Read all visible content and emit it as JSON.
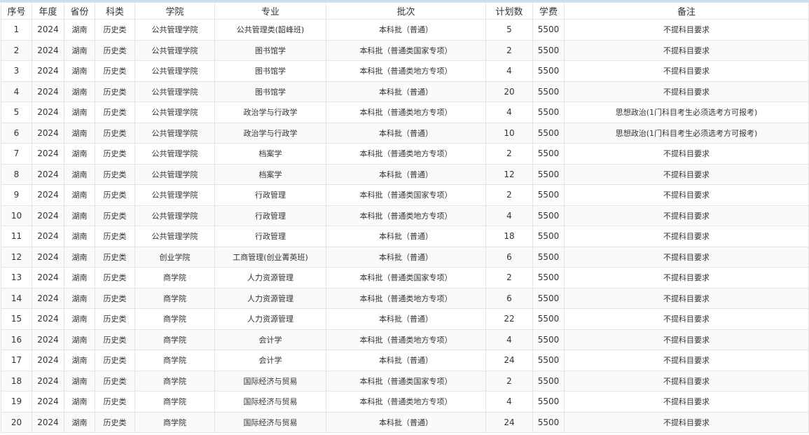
{
  "columns": [
    "序号",
    "年度",
    "省份",
    "科类",
    "学院",
    "专业",
    "批次",
    "计划数",
    "学费",
    "备注"
  ],
  "rows": [
    [
      "1",
      "2024",
      "湖南",
      "历史类",
      "公共管理学院",
      "公共管理类(韶峰班)",
      "本科批（普通）",
      "5",
      "5500",
      "不提科目要求"
    ],
    [
      "2",
      "2024",
      "湖南",
      "历史类",
      "公共管理学院",
      "图书馆学",
      "本科批（普通类国家专项）",
      "2",
      "5500",
      "不提科目要求"
    ],
    [
      "3",
      "2024",
      "湖南",
      "历史类",
      "公共管理学院",
      "图书馆学",
      "本科批（普通类地方专项）",
      "4",
      "5500",
      "不提科目要求"
    ],
    [
      "4",
      "2024",
      "湖南",
      "历史类",
      "公共管理学院",
      "图书馆学",
      "本科批（普通）",
      "20",
      "5500",
      "不提科目要求"
    ],
    [
      "5",
      "2024",
      "湖南",
      "历史类",
      "公共管理学院",
      "政治学与行政学",
      "本科批（普通类地方专项）",
      "4",
      "5500",
      "思想政治(1门科目考生必须选考方可报考)"
    ],
    [
      "6",
      "2024",
      "湖南",
      "历史类",
      "公共管理学院",
      "政治学与行政学",
      "本科批（普通）",
      "10",
      "5500",
      "思想政治(1门科目考生必须选考方可报考)"
    ],
    [
      "7",
      "2024",
      "湖南",
      "历史类",
      "公共管理学院",
      "档案学",
      "本科批（普通类地方专项）",
      "2",
      "5500",
      "不提科目要求"
    ],
    [
      "8",
      "2024",
      "湖南",
      "历史类",
      "公共管理学院",
      "档案学",
      "本科批（普通）",
      "12",
      "5500",
      "不提科目要求"
    ],
    [
      "9",
      "2024",
      "湖南",
      "历史类",
      "公共管理学院",
      "行政管理",
      "本科批（普通类国家专项）",
      "2",
      "5500",
      "不提科目要求"
    ],
    [
      "10",
      "2024",
      "湖南",
      "历史类",
      "公共管理学院",
      "行政管理",
      "本科批（普通类地方专项）",
      "4",
      "5500",
      "不提科目要求"
    ],
    [
      "11",
      "2024",
      "湖南",
      "历史类",
      "公共管理学院",
      "行政管理",
      "本科批（普通）",
      "18",
      "5500",
      "不提科目要求"
    ],
    [
      "12",
      "2024",
      "湖南",
      "历史类",
      "创业学院",
      "工商管理(创业菁英班)",
      "本科批（普通）",
      "6",
      "5500",
      "不提科目要求"
    ],
    [
      "13",
      "2024",
      "湖南",
      "历史类",
      "商学院",
      "人力资源管理",
      "本科批（普通类国家专项）",
      "2",
      "5500",
      "不提科目要求"
    ],
    [
      "14",
      "2024",
      "湖南",
      "历史类",
      "商学院",
      "人力资源管理",
      "本科批（普通类地方专项）",
      "6",
      "5500",
      "不提科目要求"
    ],
    [
      "15",
      "2024",
      "湖南",
      "历史类",
      "商学院",
      "人力资源管理",
      "本科批（普通）",
      "22",
      "5500",
      "不提科目要求"
    ],
    [
      "16",
      "2024",
      "湖南",
      "历史类",
      "商学院",
      "会计学",
      "本科批（普通类地方专项）",
      "4",
      "5500",
      "不提科目要求"
    ],
    [
      "17",
      "2024",
      "湖南",
      "历史类",
      "商学院",
      "会计学",
      "本科批（普通）",
      "24",
      "5500",
      "不提科目要求"
    ],
    [
      "18",
      "2024",
      "湖南",
      "历史类",
      "商学院",
      "国际经济与贸易",
      "本科批（普通类国家专项）",
      "2",
      "5500",
      "不提科目要求"
    ],
    [
      "19",
      "2024",
      "湖南",
      "历史类",
      "商学院",
      "国际经济与贸易",
      "本科批（普通类地方专项）",
      "4",
      "5500",
      "不提科目要求"
    ],
    [
      "20",
      "2024",
      "湖南",
      "历史类",
      "商学院",
      "国际经济与贸易",
      "本科批（普通）",
      "24",
      "5500",
      "不提科目要求"
    ]
  ]
}
